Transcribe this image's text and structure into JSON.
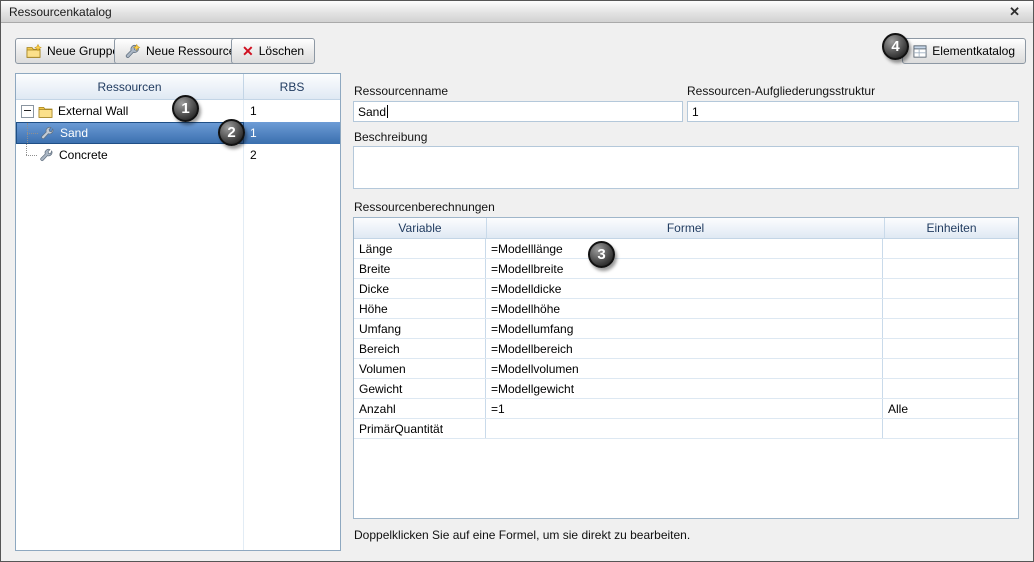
{
  "window": {
    "title": "Ressourcenkatalog",
    "close_icon": "✕"
  },
  "toolbar": {
    "buttons": [
      {
        "label": "Neue Gruppe"
      },
      {
        "label": "Neue Ressource"
      },
      {
        "label": "Löschen"
      },
      {
        "label": "Elementkatalog"
      }
    ]
  },
  "tree": {
    "columns": [
      "Ressourcen",
      "RBS"
    ],
    "items": [
      {
        "label": "External Wall",
        "rbs": "1",
        "type": "group",
        "selected": false
      },
      {
        "label": "Sand",
        "rbs": "1",
        "type": "resource",
        "selected": true
      },
      {
        "label": "Concrete",
        "rbs": "2",
        "type": "resource",
        "selected": false
      }
    ]
  },
  "form": {
    "name_label": "Ressourcenname",
    "name_value": "Sand",
    "rbs_label": "Ressourcen-Aufgliederungsstruktur",
    "rbs_value": "1",
    "description_label": "Beschreibung",
    "description_value": "",
    "calculations_label": "Ressourcenberechnungen",
    "hint": "Doppelklicken Sie auf eine Formel, um sie direkt zu bearbeiten."
  },
  "calc_table": {
    "columns": [
      "Variable",
      "Formel",
      "Einheiten"
    ],
    "rows": [
      {
        "variable": "Länge",
        "formel": "=Modelllänge",
        "einheiten": ""
      },
      {
        "variable": "Breite",
        "formel": "=Modellbreite",
        "einheiten": ""
      },
      {
        "variable": "Dicke",
        "formel": "=Modelldicke",
        "einheiten": ""
      },
      {
        "variable": "Höhe",
        "formel": "=Modellhöhe",
        "einheiten": ""
      },
      {
        "variable": "Umfang",
        "formel": "=Modellumfang",
        "einheiten": ""
      },
      {
        "variable": "Bereich",
        "formel": "=Modellbereich",
        "einheiten": ""
      },
      {
        "variable": "Volumen",
        "formel": "=Modellvolumen",
        "einheiten": ""
      },
      {
        "variable": "Gewicht",
        "formel": "=Modellgewicht",
        "einheiten": ""
      },
      {
        "variable": "Anzahl",
        "formel": "=1",
        "einheiten": "Alle"
      },
      {
        "variable": "PrimärQuantität",
        "formel": "",
        "einheiten": ""
      }
    ]
  },
  "callouts": {
    "one": "1",
    "two": "2",
    "three": "3",
    "four": "4"
  },
  "colors": {
    "selection": "#3a6fae",
    "grid_line": "#c9daea",
    "callout_bg": "#131313"
  }
}
